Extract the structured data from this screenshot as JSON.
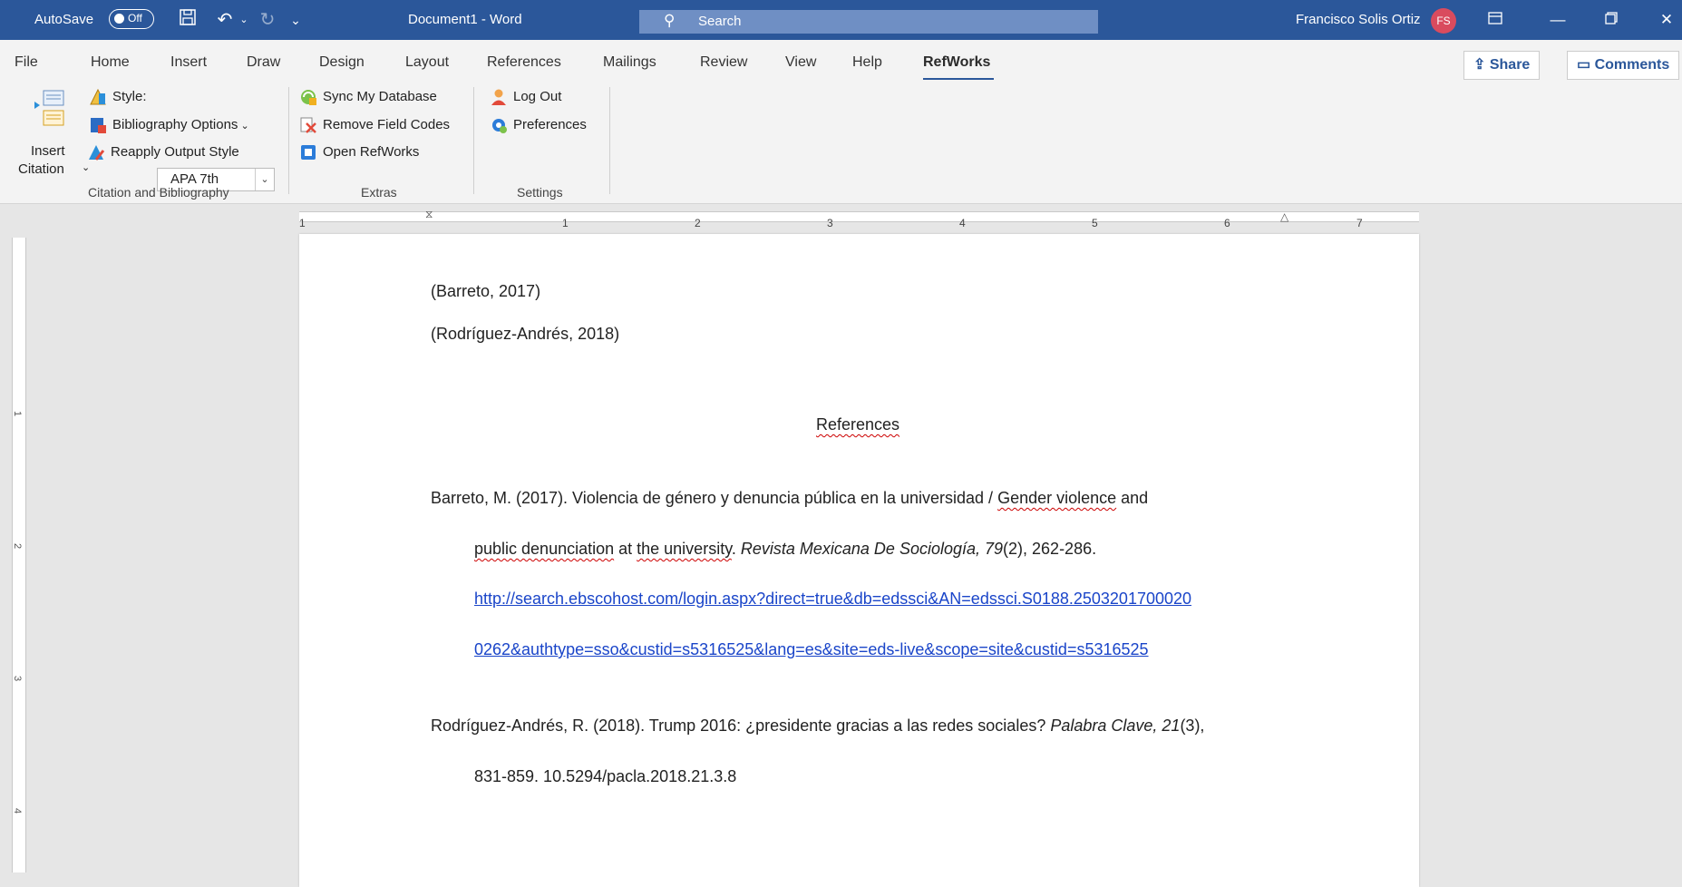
{
  "titlebar": {
    "autosave_label": "AutoSave",
    "autosave_state": "Off",
    "doc_title": "Document1  -  Word",
    "search_placeholder": "Search",
    "user_name": "Francisco Solis Ortiz",
    "user_initials": "FS",
    "bg_color": "#2b579a"
  },
  "tabs": [
    "File",
    "Home",
    "Insert",
    "Draw",
    "Design",
    "Layout",
    "References",
    "Mailings",
    "Review",
    "View",
    "Help",
    "RefWorks"
  ],
  "active_tab": "RefWorks",
  "header_buttons": {
    "share": "Share",
    "comments": "Comments"
  },
  "ribbon": {
    "insert_citation_1": "Insert",
    "insert_citation_2": "Citation",
    "style_label": "Style:",
    "style_value": "APA 7th",
    "bibliography_options": "Bibliography Options",
    "reapply_output_style": "Reapply Output Style",
    "sync_my_database": "Sync My Database",
    "remove_field_codes": "Remove Field Codes",
    "open_refworks": "Open RefWorks",
    "log_out": "Log Out",
    "preferences": "Preferences",
    "group_citation": "Citation and Bibliography",
    "group_extras": "Extras",
    "group_settings": "Settings"
  },
  "ruler": {
    "numbers": [
      "1",
      "1",
      "2",
      "3",
      "4",
      "5",
      "6",
      "7"
    ],
    "vertical_numbers": [
      "1",
      "2",
      "3",
      "4"
    ]
  },
  "document": {
    "citation_1": "(Barreto, 2017)",
    "citation_2": "(Rodríguez-Andrés, 2018)",
    "references_heading": "References",
    "ref1_line1_a": "Barreto, M. (2017). Violencia de género y denuncia pública en la universidad / ",
    "ref1_line1_b": "Gender violence",
    "ref1_line1_c": " and",
    "ref1_line2_a": "public denunciation",
    "ref1_line2_b": " at ",
    "ref1_line2_c": "the university",
    "ref1_line2_d": ". ",
    "ref1_line2_journal": "Revista Mexicana De Sociología, 79",
    "ref1_line2_e": "(2), 262-286.",
    "ref1_url_1": "http://search.ebscohost.com/login.aspx?direct=true&db=edssci&AN=edssci.S0188.2503201700020",
    "ref1_url_2": "0262&authtype=sso&custid=s5316525&lang=es&site=eds-live&scope=site&custid=s5316525",
    "ref2_line1_a": "Rodríguez-Andrés, R. (2018). Trump 2016: ¿presidente gracias a las redes sociales? ",
    "ref2_line1_journal": "Palabra Clave, 21",
    "ref2_line1_b": "(3),",
    "ref2_line2": "831-859. 10.5294/pacla.2018.21.3.8"
  }
}
